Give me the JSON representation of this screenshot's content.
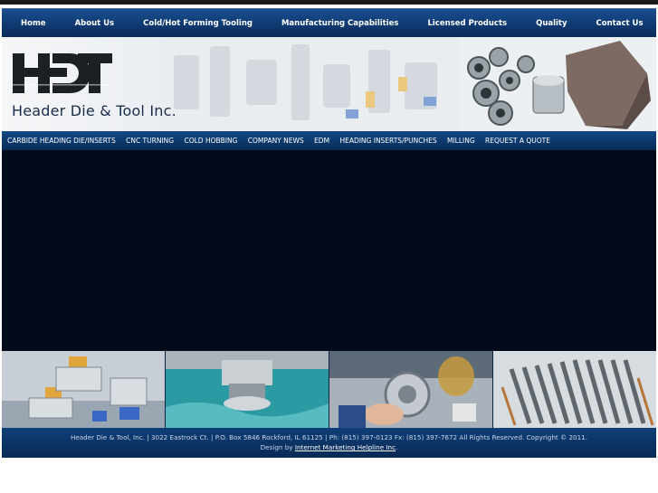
{
  "top_nav": [
    "Home",
    "About Us",
    "Cold/Hot Forming Tooling",
    "Manufacturing Capabilities",
    "Licensed Products",
    "Quality",
    "Contact Us"
  ],
  "header": {
    "logo_letters": "HDT",
    "company_name": "Header Die & Tool Inc."
  },
  "sub_nav": [
    "CARBIDE HEADING DIE/INSERTS",
    "CNC TURNING",
    "COLD HOBBING",
    "COMPANY NEWS",
    "EDM",
    "HEADING INSERTS/PUNCHES",
    "MILLING",
    "REQUEST A QUOTE"
  ],
  "footer": {
    "line1": "Header Die & Tool, Inc. | 3022 Eastrock Ct. | P.O. Box 5846 Rockford, IL 61125 | Ph: (815) 397-0123 Fx: (815) 397-7672 All Rights Reserved. Copyright © 2011.",
    "design_prefix": "Design by ",
    "design_link": "Internet Marketing Helpline Inc",
    "design_suffix": "."
  },
  "colors": {
    "nav_blue": "#0f3a72",
    "main_bg": "#030a19",
    "footer_blue": "#0a3468"
  }
}
